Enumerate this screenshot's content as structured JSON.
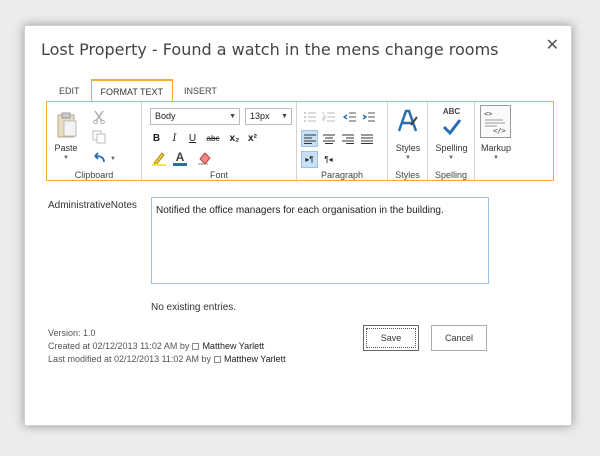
{
  "dialog": {
    "title": "Lost Property - Found a watch in the mens change rooms",
    "close_glyph": "✕"
  },
  "tabs": [
    {
      "label": "EDIT",
      "active": false
    },
    {
      "label": "FORMAT TEXT",
      "active": true
    },
    {
      "label": "INSERT",
      "active": false
    }
  ],
  "ribbon": {
    "clipboard": {
      "paste_label": "Paste",
      "group_label": "Clipboard"
    },
    "font": {
      "style_value": "Body",
      "size_value": "13px",
      "bold": "B",
      "italic": "I",
      "underline": "U",
      "strike": "abc",
      "subscript": "x₂",
      "superscript": "x²",
      "font_color_letter": "A",
      "group_label": "Font"
    },
    "paragraph": {
      "group_label": "Paragraph"
    },
    "styles": {
      "label": "Styles",
      "group_label": "Styles"
    },
    "spelling": {
      "label": "Spelling",
      "abc": "ABC",
      "group_label": "Spelling"
    },
    "markup": {
      "label": "Markup"
    }
  },
  "form": {
    "field_label": "AdministrativeNotes",
    "field_value": "Notified the office managers for each organisation in the building.",
    "history": "No existing entries."
  },
  "meta": {
    "version": "Version: 1.0",
    "created_prefix": "Created at 02/12/2013 11:02 AM  by",
    "created_user": "Matthew Yarlett",
    "modified_prefix": "Last modified at 02/12/2013 11:02 AM  by",
    "modified_user": "Matthew Yarlett"
  },
  "buttons": {
    "save": "Save",
    "cancel": "Cancel"
  },
  "colors": {
    "accent": "#f5a93b",
    "selected": "#c8e0f4",
    "field_border": "#9dc2e5",
    "icon_blue": "#2b6cb0"
  }
}
